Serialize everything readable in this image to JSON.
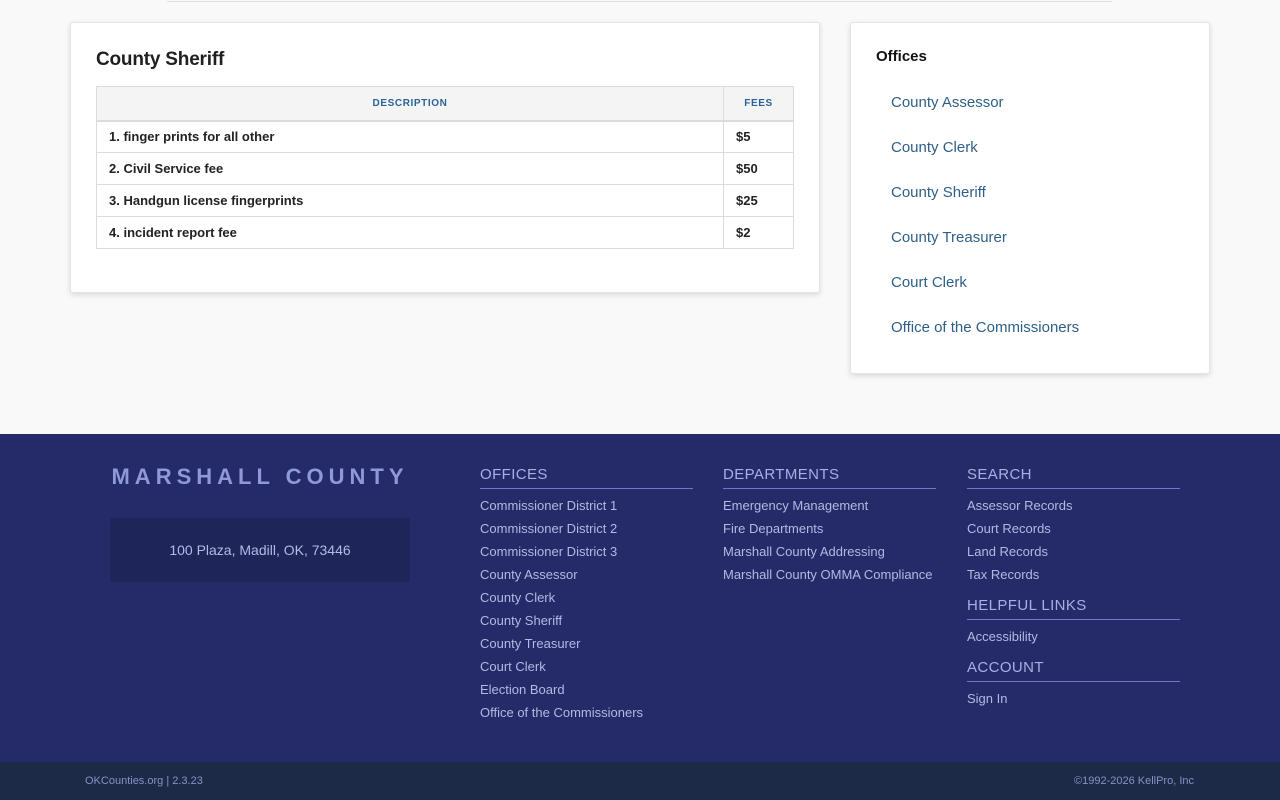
{
  "main": {
    "title": "County Sheriff",
    "table": {
      "headers": [
        "DESCRIPTION",
        "FEES"
      ],
      "rows": [
        {
          "description": "1. finger prints for all other",
          "fee": "$5"
        },
        {
          "description": "2. Civil Service fee",
          "fee": "$50"
        },
        {
          "description": "3. Handgun license fingerprints",
          "fee": "$25"
        },
        {
          "description": "4. incident report fee",
          "fee": "$2"
        }
      ]
    }
  },
  "sidebar": {
    "title": "Offices",
    "links": [
      "County Assessor",
      "County Clerk",
      "County Sheriff",
      "County Treasurer",
      "Court Clerk",
      "Office of the Commissioners"
    ]
  },
  "footer": {
    "brand": "MARSHALL COUNTY",
    "address": "100 Plaza, Madill, OK, 73446",
    "offices": {
      "title": "OFFICES",
      "links": [
        "Commissioner District 1",
        "Commissioner District 2",
        "Commissioner District 3",
        "County Assessor",
        "County Clerk",
        "County Sheriff",
        "County Treasurer",
        "Court Clerk",
        "Election Board",
        "Office of the Commissioners"
      ]
    },
    "departments": {
      "title": "DEPARTMENTS",
      "links": [
        "Emergency Management",
        "Fire Departments",
        "Marshall County Addressing",
        "Marshall County OMMA Compliance"
      ]
    },
    "search": {
      "title": "SEARCH",
      "links": [
        "Assessor Records",
        "Court Records",
        "Land Records",
        "Tax Records"
      ]
    },
    "helpful": {
      "title": "HELPFUL LINKS",
      "links": [
        "Accessibility"
      ]
    },
    "account": {
      "title": "ACCOUNT",
      "links": [
        "Sign In"
      ]
    }
  },
  "bottom": {
    "site_link": "OKCounties.org",
    "version": "| 2.3.23",
    "copyright": "©1992-2026 KellPro, Inc"
  },
  "colors": {
    "footer_bg": "#242b68",
    "bottom_bar_bg": "#1c2947",
    "link": "#2e5f88",
    "table_header": "#2a6496"
  }
}
